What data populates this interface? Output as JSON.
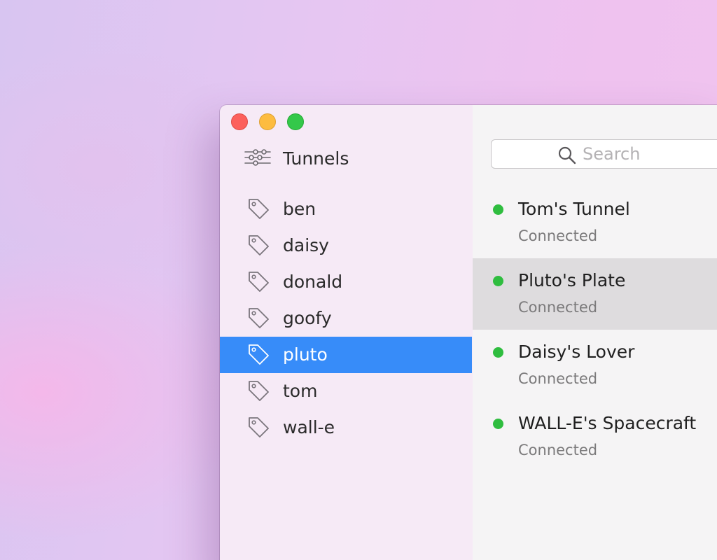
{
  "sidebar": {
    "header": {
      "label": "Tunnels",
      "icon": "sliders-icon"
    },
    "tags": [
      {
        "label": "ben",
        "icon": "tag-icon"
      },
      {
        "label": "daisy",
        "icon": "tag-icon"
      },
      {
        "label": "donald",
        "icon": "tag-icon"
      },
      {
        "label": "goofy",
        "icon": "tag-icon"
      },
      {
        "label": "pluto",
        "icon": "tag-icon",
        "selected": true
      },
      {
        "label": "tom",
        "icon": "tag-icon"
      },
      {
        "label": "wall-e",
        "icon": "tag-icon"
      }
    ],
    "selected_color": "#378cf9"
  },
  "search": {
    "placeholder": "Search",
    "value": ""
  },
  "tunnels": [
    {
      "name": "Tom's Tunnel",
      "status": "Connected",
      "status_color": "#2fbd3f"
    },
    {
      "name": "Pluto's Plate",
      "status": "Connected",
      "status_color": "#2fbd3f",
      "highlighted": true
    },
    {
      "name": "Daisy's Lover",
      "status": "Connected",
      "status_color": "#2fbd3f"
    },
    {
      "name": "WALL-E's Spacecraft",
      "status": "Connected",
      "status_color": "#2fbd3f"
    }
  ],
  "window_controls": {
    "close_color": "#fc605c",
    "minimize_color": "#fdbc40",
    "maximize_color": "#34c84a"
  }
}
